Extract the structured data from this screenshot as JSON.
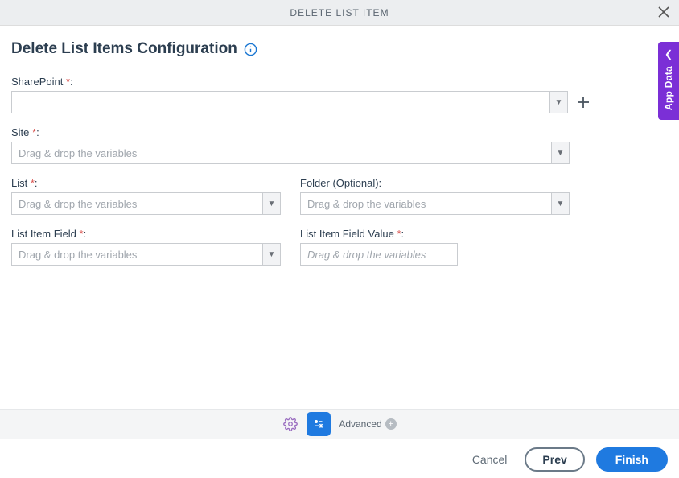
{
  "header": {
    "title": "DELETE LIST ITEM"
  },
  "page": {
    "title": "Delete List Items Configuration"
  },
  "side_panel": {
    "label": "App Data"
  },
  "fields": {
    "sharepoint": {
      "label": "SharePoint",
      "required_mark": "*",
      "value": ""
    },
    "site": {
      "label": "Site",
      "required_mark": "*",
      "placeholder": "Drag & drop the variables"
    },
    "list": {
      "label": "List",
      "required_mark": "*",
      "placeholder": "Drag & drop the variables"
    },
    "folder": {
      "label": "Folder (Optional)",
      "colon": ":",
      "placeholder": "Drag & drop the variables"
    },
    "list_item_field": {
      "label": "List Item Field",
      "required_mark": "*",
      "placeholder": "Drag & drop the variables"
    },
    "list_item_field_value": {
      "label": "List Item Field Value",
      "required_mark": "*",
      "placeholder": "Drag & drop the variables"
    }
  },
  "toolbar": {
    "advanced_label": "Advanced"
  },
  "footer": {
    "cancel": "Cancel",
    "prev": "Prev",
    "finish": "Finish"
  }
}
